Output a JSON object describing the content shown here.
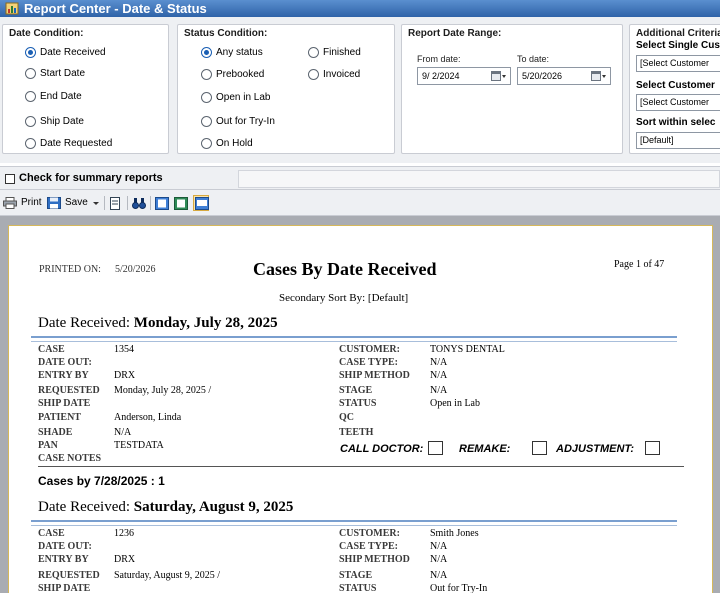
{
  "window": {
    "title": "Report Center - Date & Status"
  },
  "date_condition": {
    "title": "Date Condition:",
    "options": [
      "Date Received",
      "Start Date",
      "End Date",
      "Ship Date",
      "Date Requested"
    ],
    "selected": "Date Received"
  },
  "status_condition": {
    "title": "Status Condition:",
    "options": [
      "Any status",
      "Prebooked",
      "Open in Lab",
      "Out for Try-In",
      "On Hold",
      "Finished",
      "Invoiced"
    ],
    "selected": "Any status"
  },
  "date_range": {
    "title": "Report Date Range:",
    "from_label": "From date:",
    "from_value": "9/ 2/2024",
    "to_label": "To date:",
    "to_value": "5/20/2026"
  },
  "additional": {
    "title": "Additional Criteria:",
    "single_customer_label": "Select Single Cus",
    "single_customer_value": "[Select Customer",
    "customer_label": "Select Customer",
    "customer_value": "[Select Customer",
    "sort_label": "Sort within selec",
    "sort_value": "[Default]"
  },
  "summary": {
    "checkbox_label": "Check for summary reports",
    "checked": false
  },
  "toolbar": {
    "print_label": "Print",
    "save_label": "Save"
  },
  "report": {
    "printed_on_label": "PRINTED ON:",
    "printed_on_value": "5/20/2026",
    "title": "Cases By Date Received",
    "page": "Page 1 of 47",
    "secondary_sort": "Secondary Sort By: [Default]",
    "sections": [
      {
        "heading_prefix": "Date Received:",
        "heading_date": "Monday, July 28, 2025",
        "case": "1354",
        "date_out": "",
        "entry_by": "DRX",
        "requested": "Monday, July 28, 2025 /",
        "patient": "Anderson, Linda",
        "shade": "N/A",
        "pan": "TESTDATA",
        "customer": "TONYS DENTAL",
        "case_type": "N/A",
        "ship_method": "N/A",
        "stage": "N/A",
        "status": "Open in Lab",
        "summary": "Cases by 7/28/2025 : 1"
      },
      {
        "heading_prefix": "Date Received:",
        "heading_date": "Saturday, August 9, 2025",
        "case": "1236",
        "date_out": "",
        "entry_by": "DRX",
        "requested": "Saturday, August 9, 2025 /",
        "customer": "Smith Jones",
        "case_type": "N/A",
        "ship_method": "N/A",
        "stage": "N/A",
        "status": "Out for Try-In"
      }
    ],
    "labels": {
      "case": "CASE",
      "date_out": "DATE OUT:",
      "entry_by": "ENTRY BY",
      "requested": "REQUESTED",
      "ship_date": "SHIP DATE",
      "patient": "PATIENT",
      "shade": "SHADE",
      "pan": "PAN",
      "case_notes": "CASE NOTES",
      "customer": "CUSTOMER:",
      "case_type": "CASE TYPE:",
      "ship_method": "SHIP METHOD",
      "stage": "STAGE",
      "status": "STATUS",
      "qc": "QC",
      "teeth": "TEETH",
      "call_doctor": "CALL DOCTOR:",
      "remake": "REMAKE:",
      "adjustment": "ADJUSTMENT:"
    }
  }
}
